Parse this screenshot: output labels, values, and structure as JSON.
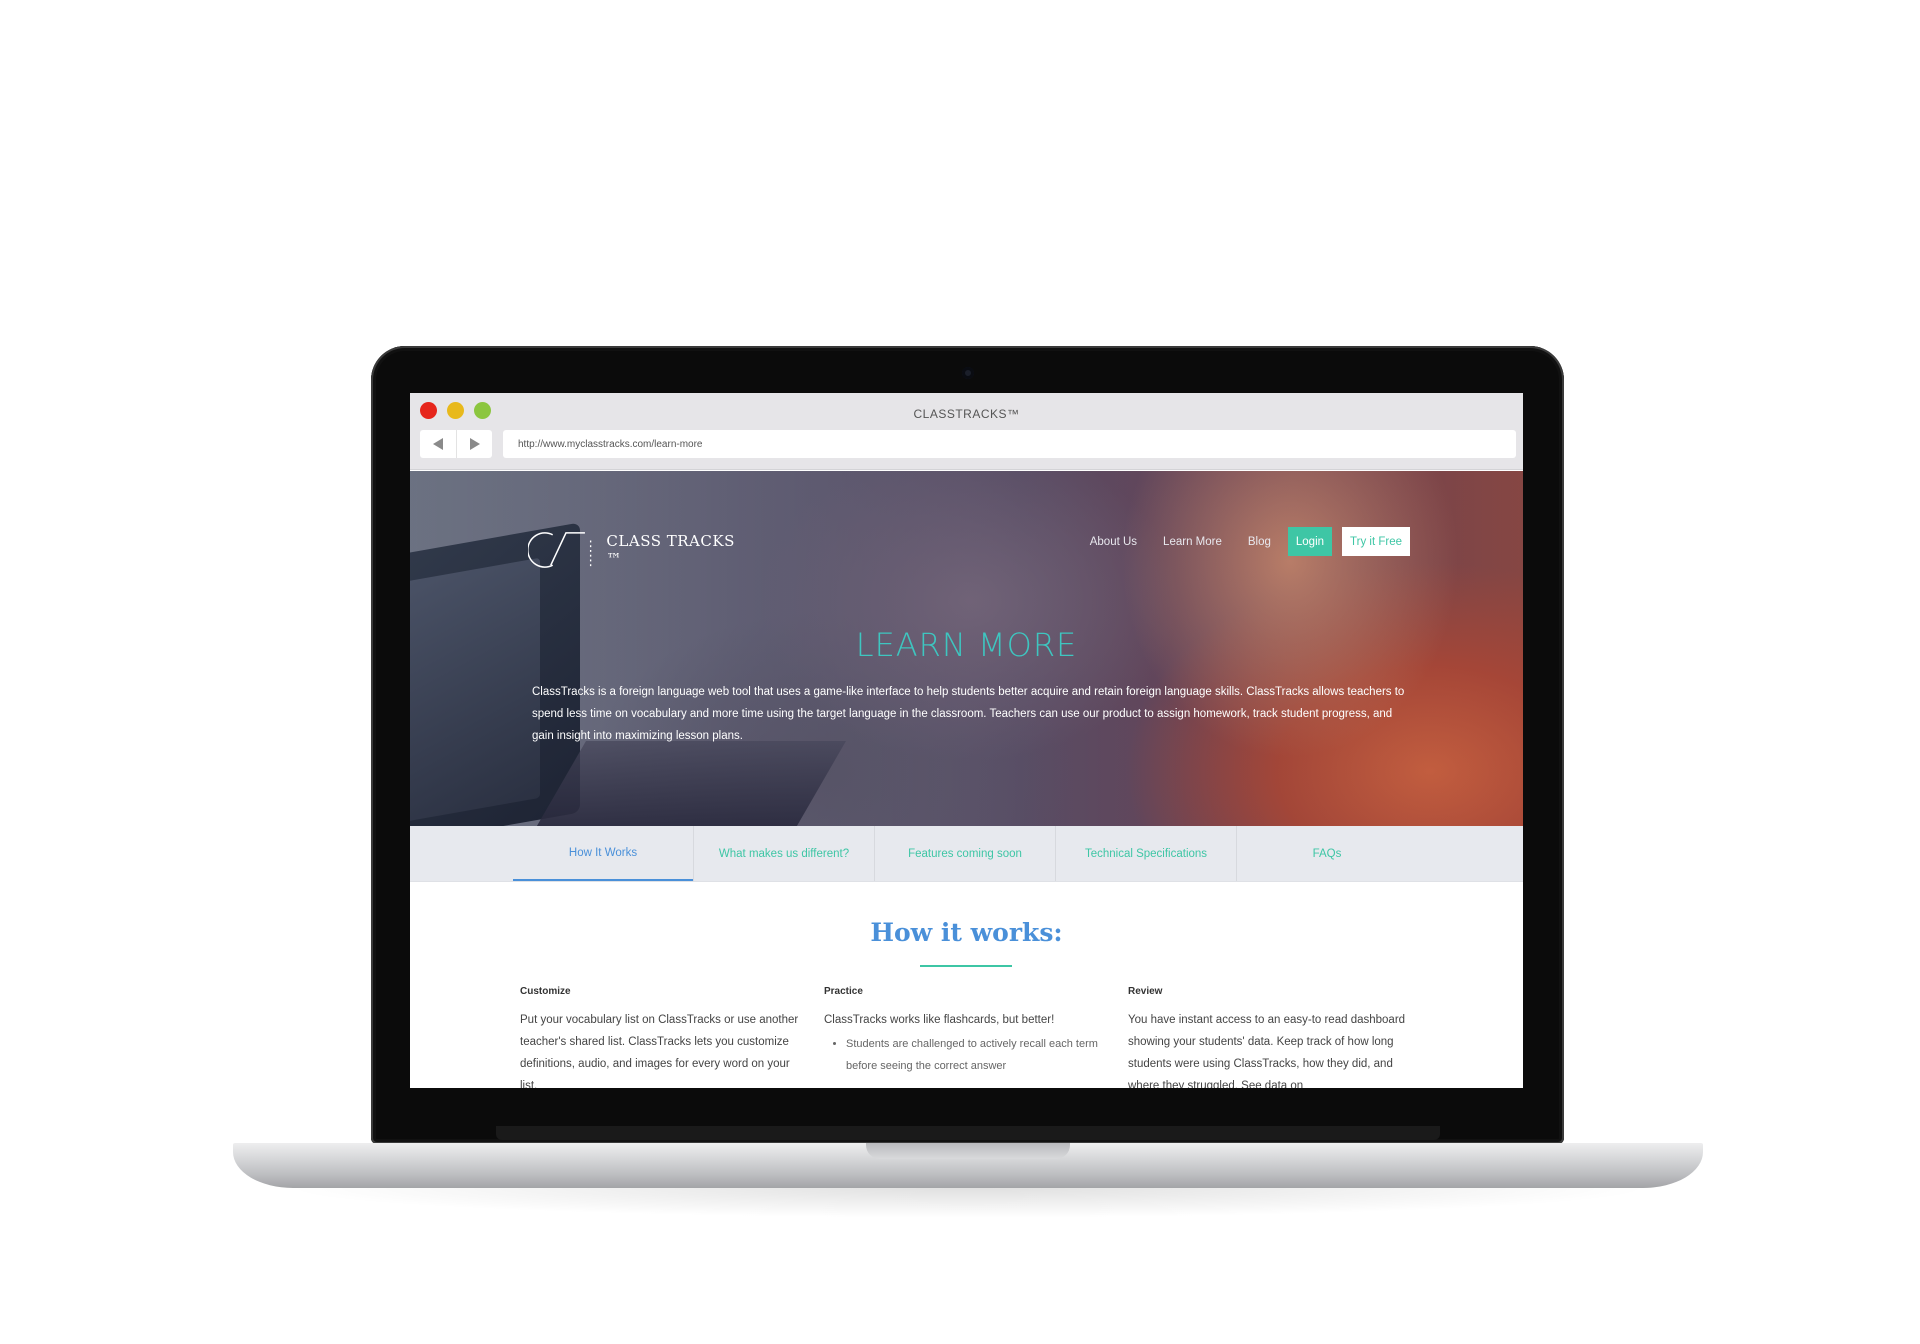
{
  "window": {
    "title": "CLASSTRACKS™",
    "url": "http://www.myclasstracks.com/learn-more"
  },
  "header": {
    "brand": "CLASS TRACKS ™",
    "nav": {
      "about": "About Us",
      "learn": "Learn More",
      "blog": "Blog",
      "login": "Login",
      "try": "Try it Free"
    }
  },
  "hero": {
    "title": "LEARN MORE",
    "text": "ClassTracks is a foreign language web tool that uses a game-like interface to help students better acquire and retain foreign language skills. ClassTracks allows teachers to spend less time on vocabulary and more time using the target language in the classroom. Teachers can use our product to assign homework, track student progress, and gain insight into maximizing lesson plans."
  },
  "tabs": [
    {
      "label": "How It Works",
      "active": true
    },
    {
      "label": "What makes us different?",
      "active": false
    },
    {
      "label": "Features coming soon",
      "active": false
    },
    {
      "label": "Technical Specifications",
      "active": false
    },
    {
      "label": "FAQs",
      "active": false
    }
  ],
  "section": {
    "title": "How it works:",
    "columns": [
      {
        "heading": "Customize",
        "text": "Put your vocabulary list on ClassTracks or use another teacher's shared list. ClassTracks lets you customize definitions, audio, and images for every word on your list."
      },
      {
        "heading": "Practice",
        "text": "ClassTracks works like flashcards, but better!",
        "bullet": "Students are challenged to actively recall each term before seeing the correct answer"
      },
      {
        "heading": "Review",
        "text": "You have instant access to an easy-to read dashboard showing your students' data. Keep track of how long students were using ClassTracks, how they did, and where they struggled. See data on"
      }
    ]
  },
  "colors": {
    "accent_green": "#3ec6a5",
    "accent_blue": "#4a90d9",
    "traffic_red": "#e6261c",
    "traffic_yellow": "#e8b91c",
    "traffic_green": "#8cc63f"
  },
  "icons": [
    "back-arrow-icon",
    "forward-arrow-icon",
    "classtracks-logo-icon",
    "bullet-icon"
  ]
}
